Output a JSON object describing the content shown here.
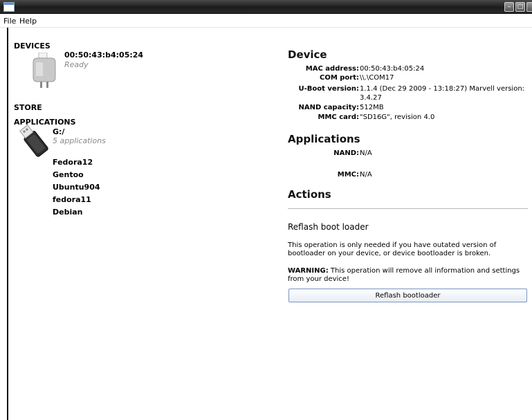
{
  "window": {
    "controls": [
      {
        "icon": "minimize-icon"
      },
      {
        "icon": "maximize-icon"
      },
      {
        "icon": "close-icon"
      }
    ]
  },
  "menu": {
    "file": "File",
    "help": "Help"
  },
  "left": {
    "devices_label": "DEVICES",
    "device": {
      "mac": "00:50:43:b4:05:24",
      "status": "Ready",
      "icon": "plug-device-icon"
    },
    "store_label": "STORE",
    "applications_label": "APPLICATIONS",
    "storage": {
      "drive": "G:/",
      "count": "5 applications",
      "icon": "usb-drive-icon"
    },
    "apps": [
      "Fedora12",
      "Gentoo",
      "Ubuntu904",
      "fedora11",
      "Debian"
    ]
  },
  "right": {
    "device_title": "Device",
    "device_info": [
      {
        "label": "MAC address:",
        "value": "00:50:43:b4:05:24"
      },
      {
        "label": "COM port:",
        "value": "\\\\.\\COM17"
      },
      {
        "label": "U-Boot version:",
        "value": "1.1.4 (Dec 29 2009 - 13:18:27) Marvell version: 3.4.27"
      },
      {
        "label": "NAND capacity:",
        "value": "512MB"
      },
      {
        "label": "MMC card:",
        "value": "\"SD16G\", revision 4.0"
      }
    ],
    "apps_title": "Applications",
    "apps_info": [
      {
        "label": "NAND:",
        "value": "N/A"
      },
      {
        "label": "MMC:",
        "value": "N/A"
      }
    ],
    "actions_title": "Actions",
    "reflash_title": "Reflash boot loader",
    "reflash_desc": "This operation is only needed if you have outated version of bootloader on your device, or device bootloader is broken.",
    "warning_label": "WARNING:",
    "warning_text": " This operation will remove all information and settings from your device!",
    "reflash_button": "Reflash bootloader"
  }
}
